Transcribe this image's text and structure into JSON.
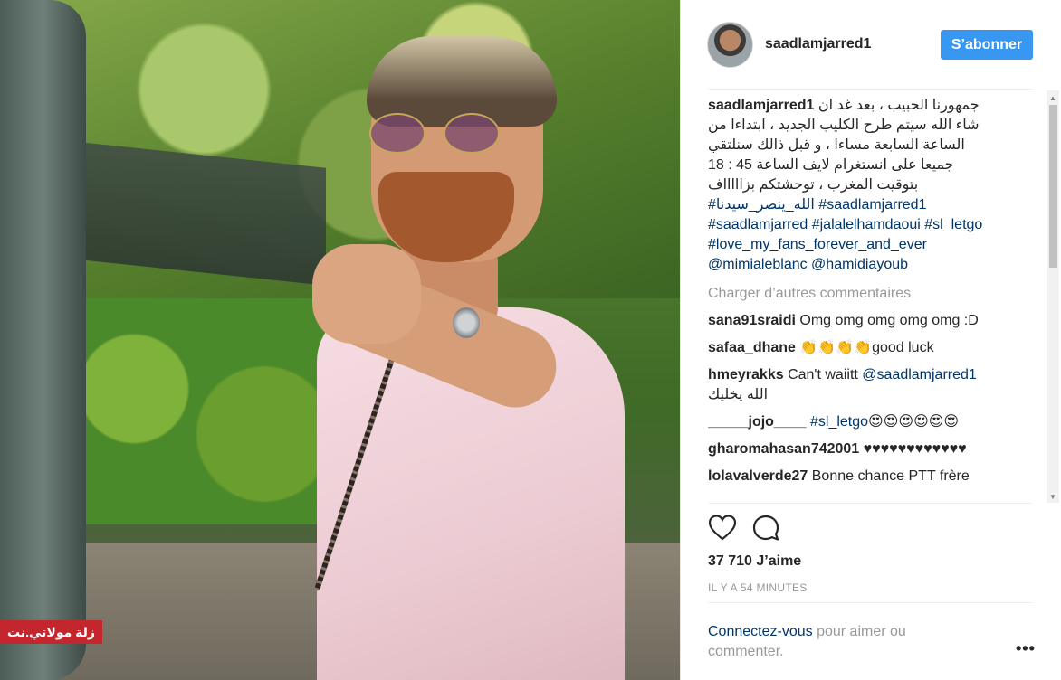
{
  "post": {
    "username": "saadlamjarred1",
    "follow_label": "S’abonner",
    "caption": {
      "username": "saadlamjarred1",
      "text_lines": [
        "جمهورنا الحبيب ، بعد غد ان",
        "شاء الله سيتم طرح الكليب الجديد ، ابتداءا من",
        "الساعة السابعة مساءا ، و قبل ذالك سنلتقي",
        "جميعا على انستغرام لايف الساعة 45 : 18",
        "بتوقيت المغرب ، توحشتكم بزاااااف"
      ],
      "hashtags_line1": "#الله_ينصر_سيدنا #saadlamjarred1",
      "hashtags_line2": "#saadlamjarred #jalalelhamdaoui #sl_letgo",
      "hashtags_line3": "#love_my_fans_forever_and_ever",
      "mentions": "@mimialeblanc @hamidiayoub"
    },
    "load_more": "Charger d’autres commentaires",
    "comments": [
      {
        "user": "sana91sraidi",
        "text": "Omg omg omg omg omg :D"
      },
      {
        "user": "safaa_dhane",
        "text": "👏👏👏👏good luck"
      },
      {
        "user": "hmeyrakks",
        "text": "Can't waiitt",
        "mention": "@saadlamjarred1",
        "text2": "الله يخليك"
      },
      {
        "user": "_____jojo____",
        "tag": "#sl_letgo",
        "text": "😍😍😍😍😍😍"
      },
      {
        "user": "gharomahasan742001",
        "text": "♥♥♥♥♥♥♥♥♥♥♥♥"
      },
      {
        "user": "lolavalverde27",
        "text": "Bonne chance PTT frère"
      }
    ],
    "likes": "37 710 J’aime",
    "time": "IL Y A 54 MINUTES",
    "login_link": "Connectez-vous",
    "login_rest": " pour aimer ou commenter.",
    "more_label": "•••"
  },
  "photo": {
    "watermark": "زلة مولاتي.نت"
  },
  "icons": {
    "heart": "heart-icon",
    "comment": "comment-icon",
    "more": "more-options-icon"
  },
  "colors": {
    "accent": "#3897f0",
    "link": "#003569",
    "muted": "#999999",
    "watermark_bg": "#c4262e"
  }
}
